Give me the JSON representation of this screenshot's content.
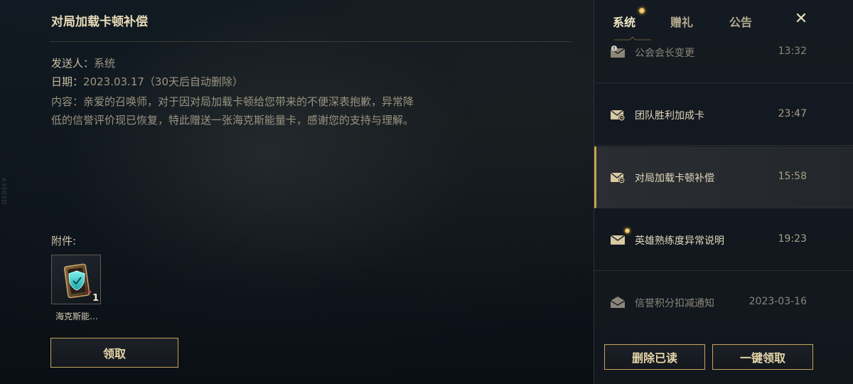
{
  "detail": {
    "title": "对局加载卡顿补偿",
    "sender_label": "发送人：",
    "sender_value": "系统",
    "date_label": "日期：",
    "date_value": "2023.03.17（30天后自动删除）",
    "content_line1": "内容：亲爱的召唤师，对于因对局加载卡顿给您带来的不便深表抱歉，异常降",
    "content_line2": "低的信誉评价现已恢复，特此赠送一张海克斯能量卡，感谢您的支持与理解。",
    "attachment_label": "附件:",
    "attachment": {
      "name": "海克斯能…",
      "count": "1",
      "icon": "hextech-energy-card-icon"
    },
    "claim_label": "领取"
  },
  "side_mark": "A3505D",
  "tabs": [
    {
      "label": "系统",
      "active": true,
      "dot": true
    },
    {
      "label": "赠礼",
      "active": false,
      "dot": false
    },
    {
      "label": "公告",
      "active": false,
      "dot": false
    }
  ],
  "close_icon": "close-icon",
  "mails": [
    {
      "subject": "公会会长变更",
      "time": "13:32",
      "icon": "notice-mail-icon",
      "state": "read"
    },
    {
      "subject": "团队胜利加成卡",
      "time": "23:47",
      "icon": "attachment-mail-icon",
      "state": "normal"
    },
    {
      "subject": "对局加载卡顿补偿",
      "time": "15:58",
      "icon": "attachment-mail-icon",
      "state": "selected"
    },
    {
      "subject": "英雄熟练度异常说明",
      "time": "19:23",
      "icon": "unread-mail-icon",
      "state": "unread"
    },
    {
      "subject": "信誉积分扣减通知",
      "time": "2023-03-16",
      "icon": "opened-mail-icon",
      "state": "read"
    }
  ],
  "actions": {
    "delete_read": "删除已读",
    "claim_all": "一键领取"
  },
  "colors": {
    "accent_gold": "#c9a24f",
    "background": "#0b1117"
  }
}
